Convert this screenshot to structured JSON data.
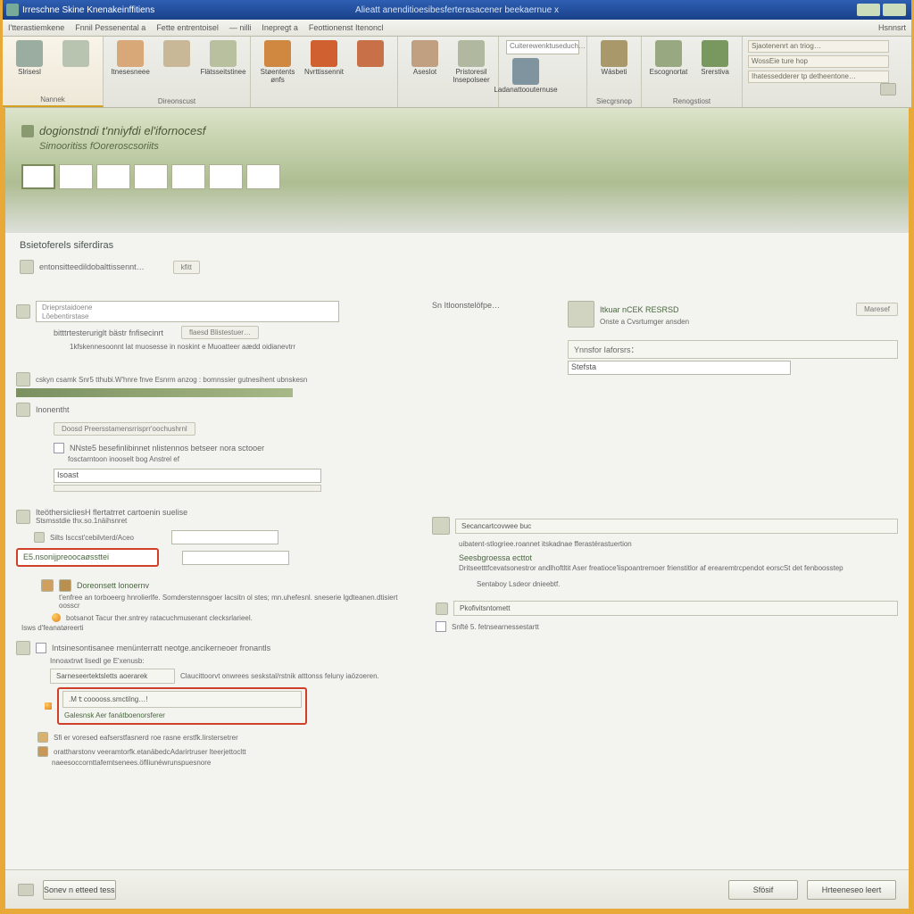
{
  "titlebar": {
    "left": "Irreschne Skine Knenakeinffitiens",
    "center": "Alieatt anenditioesibesferterasacener beekaernue x"
  },
  "menubar": {
    "items": [
      "I'tterastiemkene",
      "Fnnil Pessenental a",
      "Fette entrentoisel",
      "— nilli",
      "Inepregt a",
      "Feottionenst Itenoncl"
    ],
    "right": "Hsnnsrt"
  },
  "ribbon": {
    "groups": [
      {
        "label": "Nannek",
        "icons": [
          {
            "label": "Slrisesl",
            "color": "#9aada0"
          },
          {
            "label": "",
            "color": "#b8c4b0"
          }
        ]
      },
      {
        "label": "Direonscust",
        "icons": [
          {
            "label": "Itnesesneee",
            "color": "#d8a878"
          },
          {
            "label": "",
            "color": "#c8b898"
          },
          {
            "label": "Flätsseitstinee",
            "color": "#b8c0a0"
          }
        ]
      },
      {
        "label": "",
        "icons": [
          {
            "label": "Støentents ønfs",
            "color": "#d08840"
          },
          {
            "label": "Nvrttissennit",
            "color": "#d06030"
          },
          {
            "label": "",
            "color": "#c87048"
          }
        ]
      },
      {
        "label": "",
        "icons": [
          {
            "label": "Aseslot",
            "color": "#c0a080"
          },
          {
            "label": "Pristoresil Insepolseer",
            "color": "#b0b8a0"
          }
        ]
      },
      {
        "label": "",
        "search": "Cuiterewenktuseduch…",
        "icons": [
          {
            "label": "Ladanattoouternuse",
            "color": "#8094a0"
          }
        ]
      },
      {
        "label": "Siecgrsnop",
        "icons": [
          {
            "label": "Wásbeti",
            "color": "#a8986a"
          }
        ]
      },
      {
        "label": "Renogstiost",
        "icons": [
          {
            "label": "Escognortat",
            "color": "#98a880"
          },
          {
            "label": "Srerstiva",
            "color": "#789860"
          }
        ]
      },
      {
        "label": "",
        "panel": [
          "Sjaotenenrt an triog…",
          "WossEie ture hop",
          "Ihatessedderer tp detheentone…"
        ]
      }
    ]
  },
  "header": {
    "title": "dogionstndi t'nniyfdi el'ifornocesf",
    "subtitle": "Simooritiss fOoreroscsoriits"
  },
  "section1_title": "Bsietoferels siferdiras",
  "section1": {
    "line1": "entonsitteedildobalttissennt…",
    "pill1": "kfitt",
    "box_line1": "Drieprstaidoene",
    "box_line2": "Lôebentirstase",
    "sub_line": "bitttrtesteruriglt bästr fnfisecinrt",
    "tab1": "flaesd Blistestuer…",
    "sub_desc": "1kfskennesoonnt lat muosesse in noskint e Muoatteer aædd oidianevtrr",
    "mid_label": "Sn Itloonstelöfpe…",
    "right_title": "Itkuar nCEK RESRSD",
    "right_btn": "Maresef",
    "right_sub": "Onste a Cvsrtumger ansden",
    "right_field_label": "Ynnsfor Iaforsrs：",
    "right_field_value": "Stefsta",
    "bottom_line": "cskyn csamk Snr5 tthubi.W'hnre fnve Esnrm anzog :    bomnssier gutnesihent ubnskesn"
  },
  "section2": {
    "left_line": "Inonentht",
    "panel_label": "Doosd Preersstamensrrisprr'oochushrnl",
    "check1": "NNste5 besefinlibinnet nlistennos betseer nora sctooer",
    "check1_sub": "fosctarntoon inooselt bog Anstrel ef",
    "input_label": "Isoast",
    "sec_title": "IteöthersicliesH flertatrret cartoenin suelise",
    "sec_sub": "Stsmsstdie thx.so.1näihsnret",
    "field1_label": "Silts Isccst'cebilvterd/Aceo",
    "btn_label": "E5.nsonijpreoocaøssttei",
    "group_title": "Doreonsett lonoernv",
    "group_desc": "t'enfree an torboeerg hnrolierlfe. Somderstennsgoer lacsitn ol stes; mn.uhefesnl. sneserie lgdteanen.dtisiert oosscr",
    "bullet1": "botsanot Tacur ther.sntrey ratacuchmuserant clecksrlarieel.",
    "footer_label": "Isws d'feanatøreerti",
    "panel2_title": "Intsinesontisanee menünterratt neotge.ancikerneoer fronantls",
    "panel2_sub": "Innoaxtrwt lisedl ge E'xenusb:",
    "panel2_field_label": "Sarneseertektsletts aoerarek",
    "panel2_field_desc": "Claucittoorvt onwrees seskstal/rstnik atttonss feluny iaözoeren.",
    "panel2_btn": "  .Mｔcooooss.smctilng…!",
    "panel2_option": "Galesnsk Aer fanátboenorsferer",
    "check2": "Sfi er voresed eafserstfasnerd roe rasne erstfk.lirstersetrer",
    "check3": "orattharstonv veeramtorfk.etanäbedcAdarirtruser lteerjettocltt",
    "check4": "naeesoccornttafemtsenees.öflliunéwrunspuesnore"
  },
  "right_col": {
    "box_label": "Secancartcovwee buc",
    "desc1": "uibatent-stlogriee.roannet itskadnae fferastérastuertion",
    "title2": "Seesbgroessa ecttot",
    "desc2": "Dritseetttfcevatsonestror andlhoftltit Aser freatioce'lispoantremoer frienstitlor af erearemtrcpendot eorscSt det fenboosstep",
    "sub_link": "Sentaboy Lsdeor dnieebtf.",
    "box2_label": "Pkofivitsntomett",
    "check_label": "Snfté 5. fetnsearnessestartt"
  },
  "footer": {
    "left": "Sonev n etteed tess",
    "ok": "Sfösif",
    "cancel": "Hrteeneseo leert"
  }
}
